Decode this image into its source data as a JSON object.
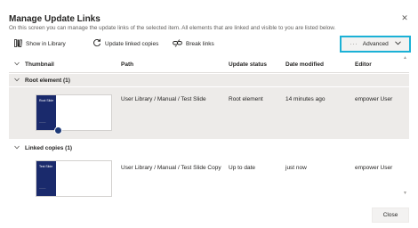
{
  "dialog": {
    "title": "Manage Update Links",
    "subtitle": "On this screen you can manage the update links of the selected item. All elements that are linked and visible to you are listed below.",
    "close_icon": "close-icon"
  },
  "toolbar": {
    "show_in_library": "Show in Library",
    "update_linked_copies": "Update linked copies",
    "break_links": "Break links",
    "advanced": "Advanced",
    "advanced_dots": "···"
  },
  "columns": {
    "thumbnail": "Thumbnail",
    "path": "Path",
    "status": "Update status",
    "modified": "Date modified",
    "editor": "Editor"
  },
  "groups": [
    {
      "label": "Root element (1)",
      "rows": [
        {
          "slide_title": "Root Slide",
          "path": "User Library / Manual / Test Slide",
          "status": "Root element",
          "modified": "14 minutes ago",
          "editor": "empower User"
        }
      ]
    },
    {
      "label": "Linked copies (1)",
      "rows": [
        {
          "slide_title": "Test Slide",
          "path": "User Library / Manual / Test Slide Copy",
          "status": "Up to date",
          "modified": "just now",
          "editor": "empower User"
        }
      ]
    }
  ],
  "footer": {
    "close_label": "Close"
  },
  "colors": {
    "accent_focus": "#1bb1d6",
    "selected_row": "#edebe9",
    "slide_dark": "#1a2a6c"
  }
}
